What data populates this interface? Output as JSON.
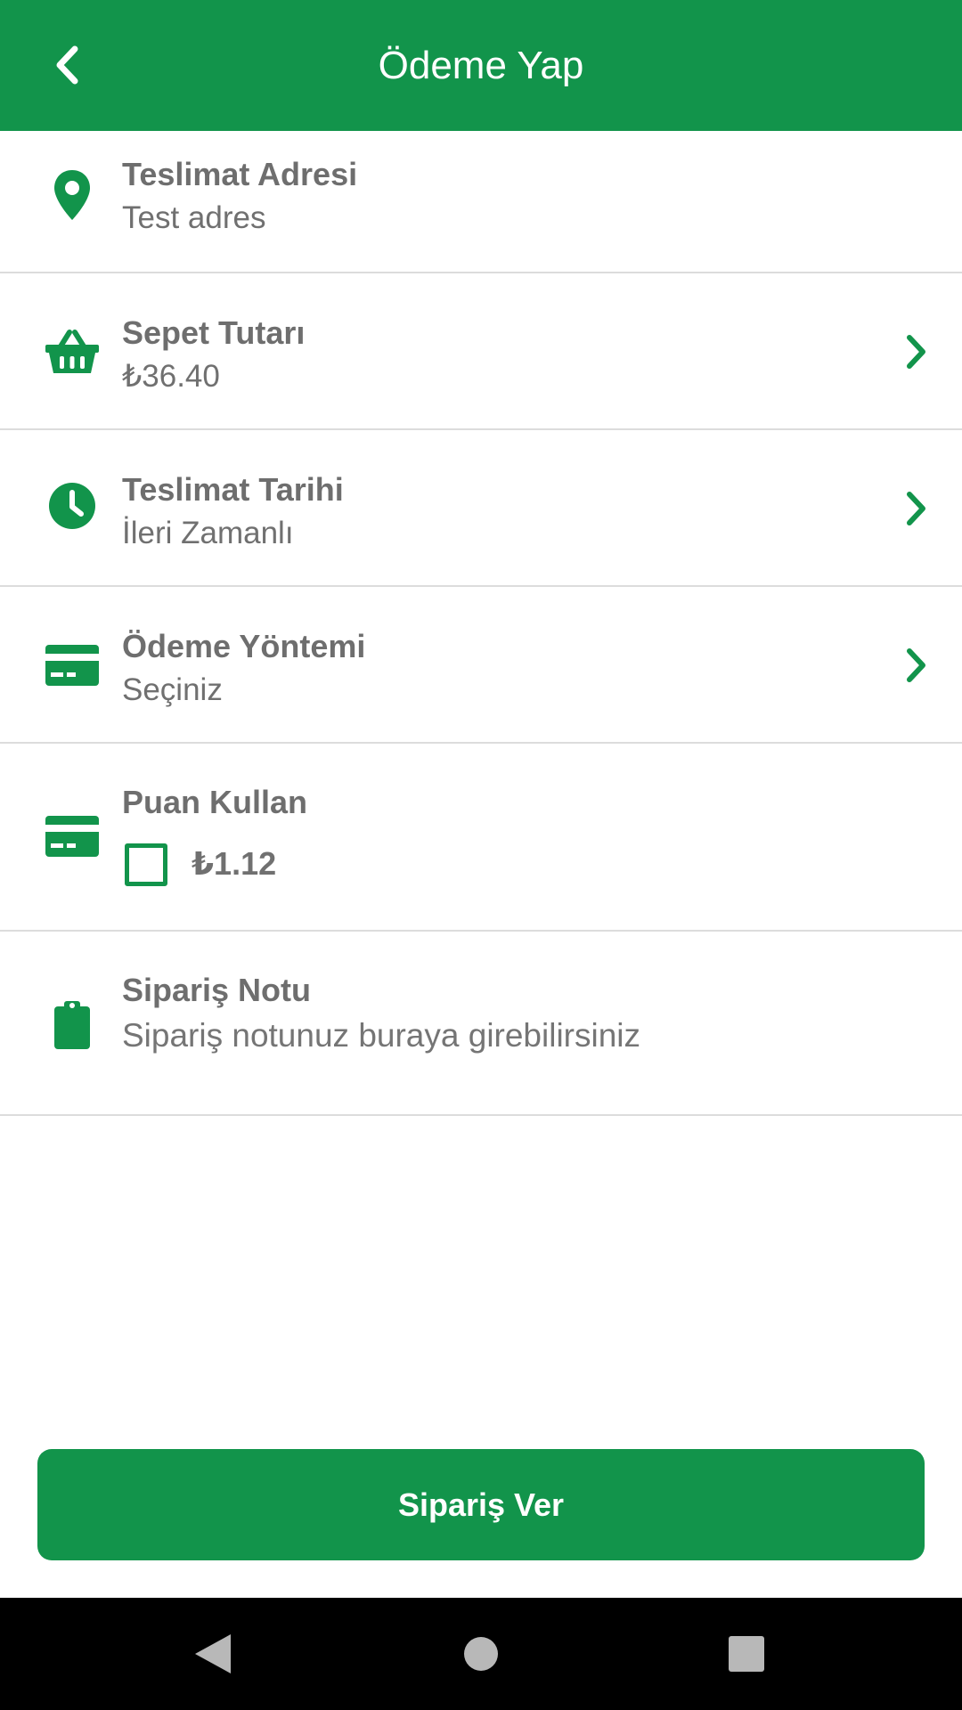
{
  "header": {
    "title": "Ödeme Yap",
    "back_icon": "chevron-left-icon"
  },
  "rows": {
    "address": {
      "label": "Teslimat Adresi",
      "value": "Test adres",
      "icon": "location-pin-icon"
    },
    "basket": {
      "label": "Sepet Tutarı",
      "value": "₺36.40",
      "icon": "basket-icon"
    },
    "delivery": {
      "label": "Teslimat Tarihi",
      "value": "İleri Zamanlı",
      "icon": "clock-icon"
    },
    "payment": {
      "label": "Ödeme Yöntemi",
      "value": "Seçiniz",
      "icon": "credit-card-icon"
    },
    "points": {
      "label": "Puan Kullan",
      "amount": "₺1.12",
      "checked": false,
      "icon": "credit-card-icon"
    },
    "note": {
      "label": "Sipariş Notu",
      "placeholder": "Sipariş notunuz buraya girebilirsiniz",
      "icon": "clipboard-icon"
    }
  },
  "submit": {
    "label": "Sipariş Ver"
  },
  "colors": {
    "accent": "#12944b",
    "text": "#6f6f6f",
    "divider": "#dcdcdc"
  },
  "nav": {
    "back_icon": "nav-back-icon",
    "home_icon": "nav-home-icon",
    "recents_icon": "nav-recents-icon"
  }
}
